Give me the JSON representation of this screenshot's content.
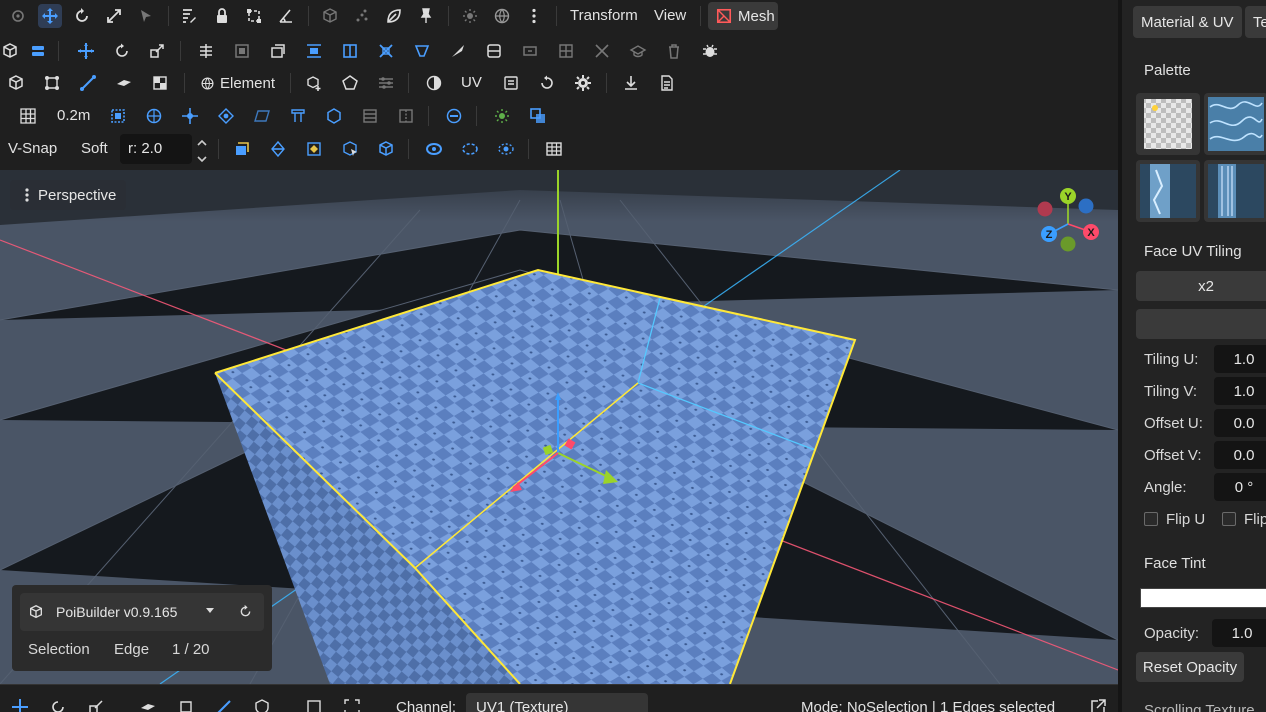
{
  "menu": {
    "transform": "Transform",
    "view": "View",
    "mesh": "Mesh"
  },
  "toolbar": {
    "element_label": "Element",
    "uv_label": "UV",
    "grid_size": "0.2m",
    "vsnap": "V-Snap",
    "soft": "Soft",
    "radius_value": "r: 2.0"
  },
  "viewport": {
    "view_label": "Perspective",
    "gizmo": {
      "y": "Y",
      "x": "X",
      "z": "Z"
    }
  },
  "info_panel": {
    "app_version": "PoiBuilder v0.9.165",
    "selection_label": "Selection",
    "selection_mode": "Edge",
    "selection_count": "1 / 20"
  },
  "bottom_bar": {
    "channel_label": "Channel:",
    "channel_value": "UV1 (Texture)",
    "status": "Mode: NoSelection | 1 Edges selected"
  },
  "right_panel": {
    "tabs": [
      "Material & UV",
      "Te"
    ],
    "palette_title": "Palette",
    "face_uv_title": "Face UV Tiling",
    "tiling_button": "x2",
    "fields": [
      {
        "label": "Tiling U:",
        "value": "1.0"
      },
      {
        "label": "Tiling V:",
        "value": "1.0"
      },
      {
        "label": "Offset U:",
        "value": "0.0"
      },
      {
        "label": "Offset V:",
        "value": "0.0"
      },
      {
        "label": "Angle:",
        "value": "0 °"
      }
    ],
    "flip_u": "Flip U",
    "flip_v": "Flip",
    "face_tint_title": "Face Tint",
    "tint_color": "#ffffff",
    "opacity_label": "Opacity:",
    "opacity_value": "1.0",
    "reset_opacity": "Reset Opacity",
    "scrolled_text": "Scrolling Texture"
  },
  "colors": {
    "accent": "#4a9eff",
    "mesh_icon": "#ff5a5a",
    "selection_edge": "#ffe838"
  }
}
